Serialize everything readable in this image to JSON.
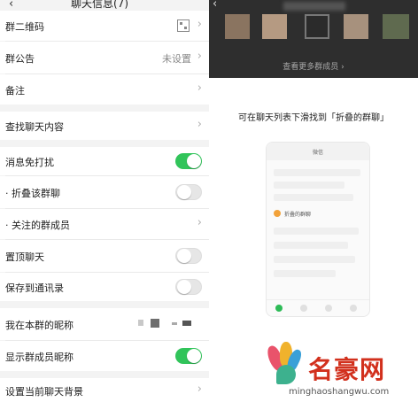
{
  "left": {
    "title": "聊天信息(7)",
    "back_glyph": "‹",
    "chevron_glyph": "›",
    "rows": {
      "qr": "群二维码",
      "notice": "群公告",
      "notice_value": "未设置",
      "remark": "备注",
      "find": "查找聊天内容",
      "mute": "消息免打扰",
      "fold": "· 折叠该群聊",
      "follow": "· 关注的群成员",
      "pin": "置顶聊天",
      "save": "保存到通讯录",
      "nickname": "我在本群的昵称",
      "show_names": "显示群成员昵称",
      "background": "设置当前聊天背景"
    },
    "toggles": {
      "mute": true,
      "fold": false,
      "pin": false,
      "save": false,
      "show_names": true
    }
  },
  "right": {
    "back_glyph": "‹",
    "more_members": "查看更多群成员 ›",
    "tip": "可在聊天列表下滑找到「折叠的群聊」",
    "phone": {
      "title": "微信",
      "folded_label": "折叠的群聊"
    }
  },
  "watermark": {
    "name": "名豪网",
    "url": "minghaoshangwu.com"
  },
  "colors": {
    "toggle_on": "#31c45a",
    "watermark_red": "#d2301d"
  }
}
